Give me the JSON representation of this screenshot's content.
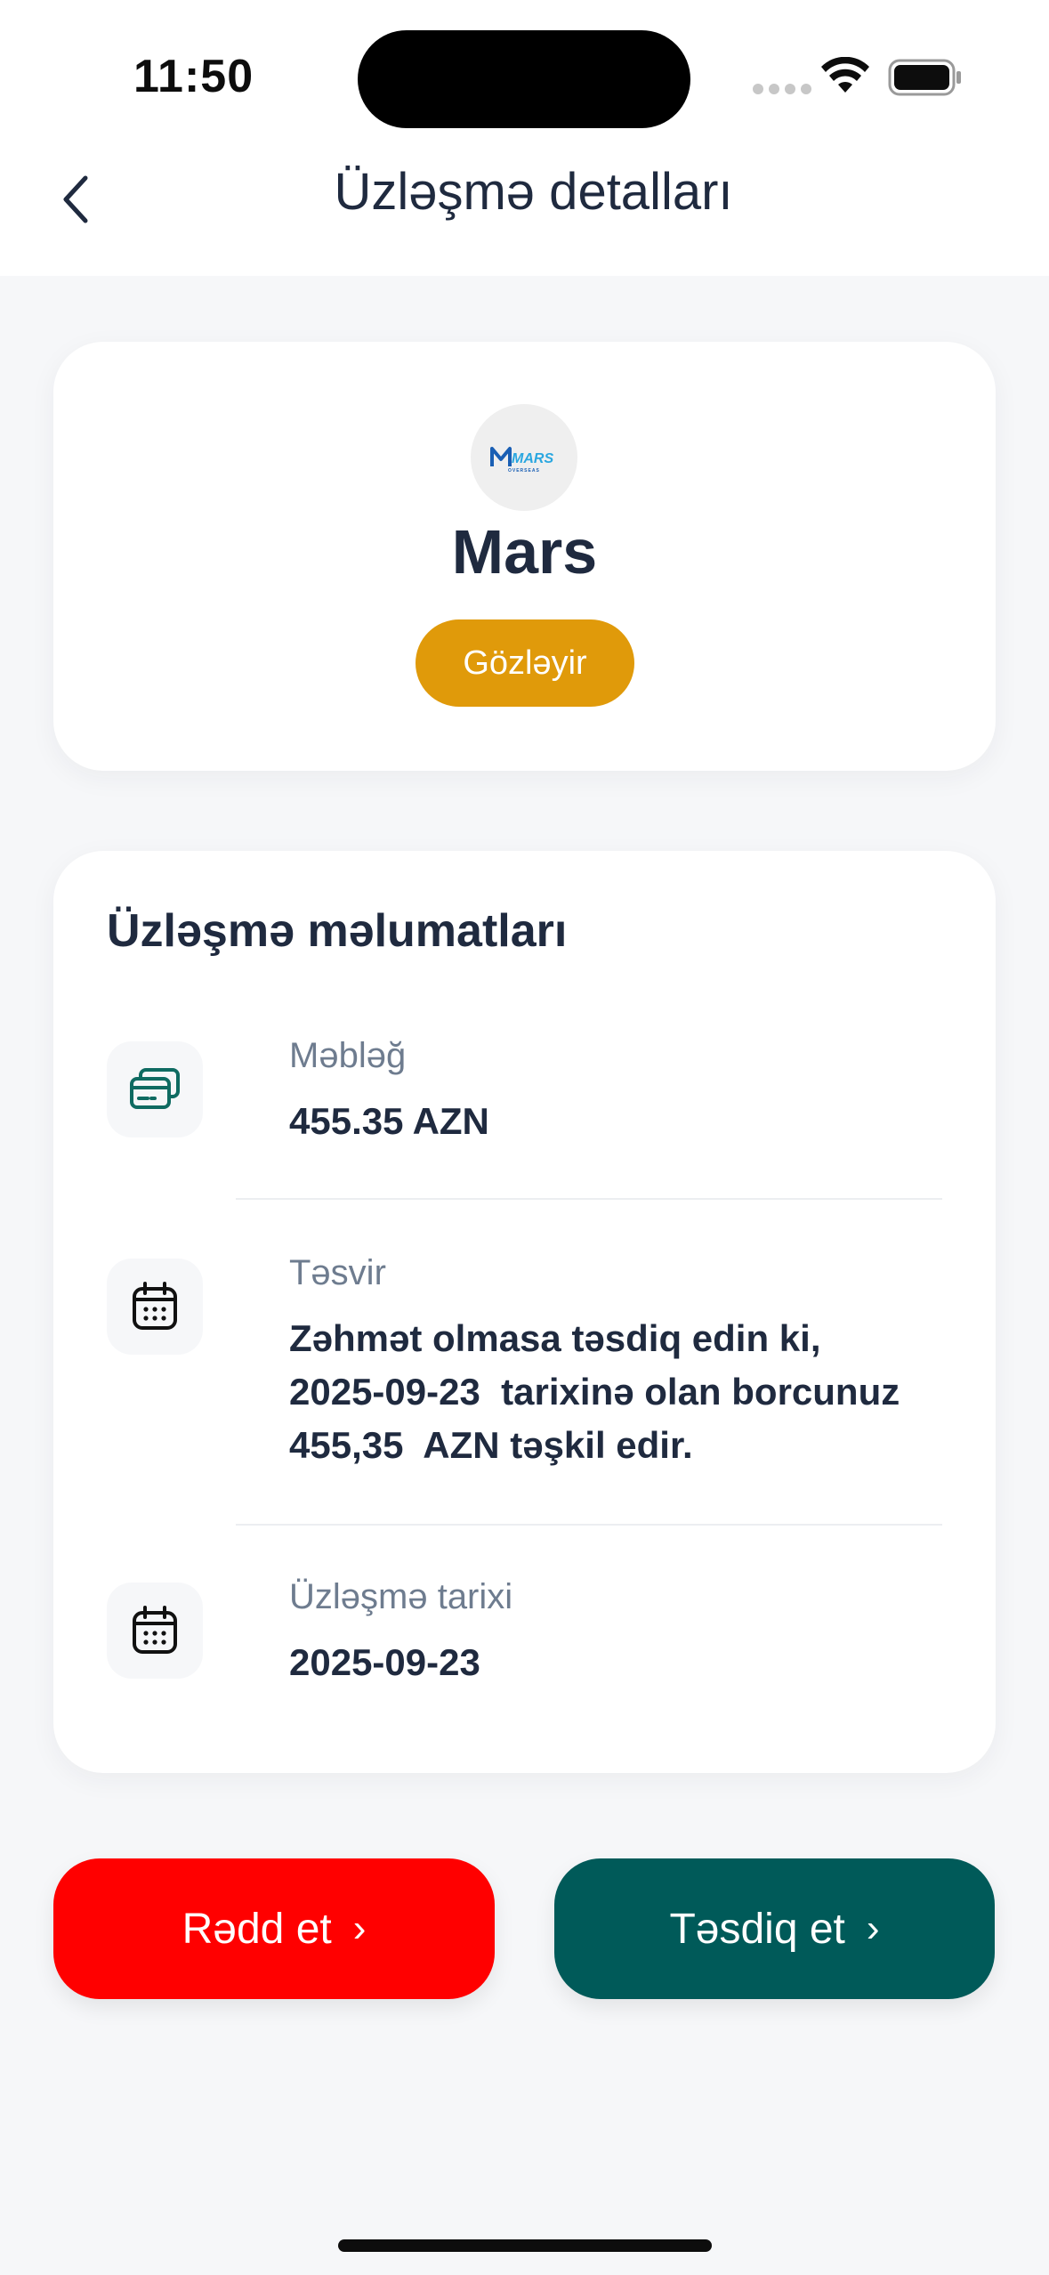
{
  "status_bar": {
    "time": "11:50"
  },
  "header": {
    "title": "Üzləşmə detalları",
    "back_icon": "chevron-left-icon"
  },
  "company": {
    "name": "Mars",
    "logo_text": "MARS",
    "logo_subtext": "OVERSEAS",
    "status": "Gözləyir",
    "status_color": "#e09a0a"
  },
  "details": {
    "section_title": "Üzləşmə məlumatları",
    "items": [
      {
        "icon": "cards-icon",
        "label": "Məbləğ",
        "value": "455.35 AZN"
      },
      {
        "icon": "calendar-icon",
        "label": "Təsvir",
        "value": "Zəhmət olmasa təsdiq edin ki,\n2025-09-23  tarixinə olan borcunuz\n455,35  AZN təşkil edir."
      },
      {
        "icon": "calendar-icon",
        "label": "Üzləşmə tarixi",
        "value": "2025-09-23"
      }
    ]
  },
  "actions": {
    "reject_label": "Rədd et",
    "confirm_label": "Təsdiq et",
    "arrow": "›",
    "reject_color": "#ff0000",
    "confirm_color": "#005a59"
  }
}
